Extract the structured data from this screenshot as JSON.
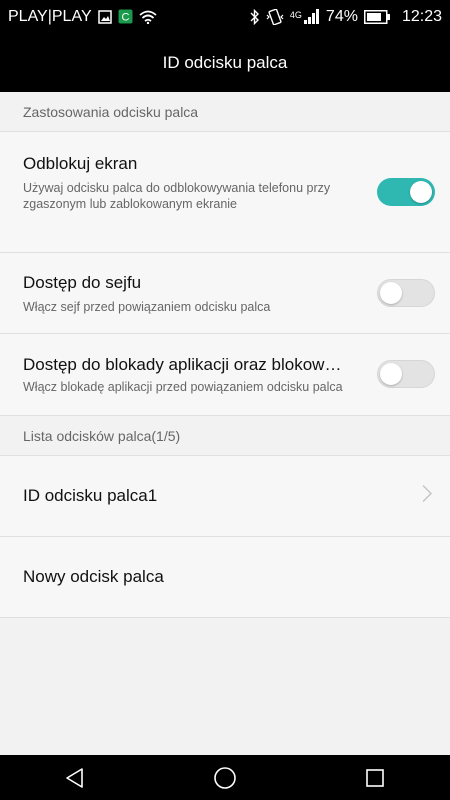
{
  "status_bar": {
    "carrier": "PLAY|PLAY",
    "battery": "74%",
    "time": "12:23",
    "network": "4G",
    "icons": [
      "image-icon",
      "app-notification-icon",
      "wifi-icon",
      "bluetooth-icon",
      "vibrate-icon",
      "signal-icon",
      "battery-icon"
    ]
  },
  "app_bar": {
    "title": "ID odcisku palca"
  },
  "sections": {
    "usage_header": "Zastosowania odcisku palca",
    "list_header": "Lista odcisków palca(1/5)"
  },
  "settings": {
    "unlock": {
      "title": "Odblokuj ekran",
      "subtitle": "Używaj odcisku palca do odblokowywania telefonu przy zgaszonym lub zablokowanym ekranie",
      "enabled": true
    },
    "safe": {
      "title": "Dostęp do sejfu",
      "subtitle": "Włącz sejf przed powiązaniem odcisku palca",
      "enabled": false
    },
    "app_lock": {
      "title": "Dostęp do blokady aplikacji oraz blokow…",
      "subtitle": "Włącz blokadę aplikacji przed powiązaniem odcisku palca",
      "enabled": false
    }
  },
  "fingerprints": {
    "items": [
      "ID odcisku palca1"
    ],
    "new_label": "Nowy odcisk palca"
  },
  "colors": {
    "accent": "#2fb8b2",
    "bar_bg": "#000000",
    "page_bg": "#f2f2f2"
  }
}
